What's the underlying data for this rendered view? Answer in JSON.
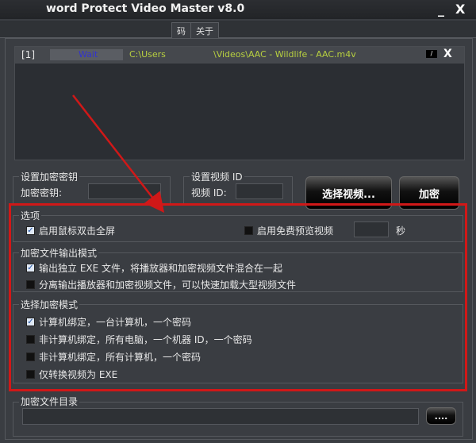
{
  "window": {
    "title": "word Protect Video Master v8.0",
    "minimize": "_",
    "close": "X"
  },
  "tabs": [
    {
      "label": "码"
    },
    {
      "label": "关于"
    }
  ],
  "file": {
    "index": "[1]",
    "status": "Wait",
    "path_start": "C:\\Users",
    "path_end": "\\Videos\\AAC - Wildlife - AAC.m4v",
    "remove": "X"
  },
  "key_group": {
    "title": "设置加密密钥",
    "label": "加密密钥:",
    "value": ""
  },
  "id_group": {
    "title": "设置视频 ID",
    "label": "视频 ID:",
    "value": ""
  },
  "buttons": {
    "select_video": "选择视频...",
    "encrypt": "加密",
    "browse": "...."
  },
  "options": {
    "title": "选项",
    "fullscreen": "启用鼠标双击全屏",
    "fullscreen_checked": true,
    "preview": "启用免费预览视频",
    "preview_checked": false,
    "preview_seconds": "",
    "seconds_unit": "秒"
  },
  "output_mode": {
    "title": "加密文件输出模式",
    "items": [
      {
        "label": "输出独立 EXE 文件，将播放器和加密视频文件混合在一起",
        "checked": true
      },
      {
        "label": "分离输出播放器和加密视频文件，可以快速加载大型视频文件",
        "checked": false
      }
    ]
  },
  "encrypt_mode": {
    "title": "选择加密模式",
    "items": [
      {
        "label": "计算机绑定，一台计算机，一个密码",
        "checked": true
      },
      {
        "label": "非计算机绑定，所有电脑，一个机器 ID，一个密码",
        "checked": false
      },
      {
        "label": "非计算机绑定，所有计算机，一个密码",
        "checked": false
      },
      {
        "label": "仅转换视频为 EXE",
        "checked": false
      }
    ]
  },
  "output_dir": {
    "title": "加密文件目录",
    "value": ""
  },
  "colors": {
    "annotation": "#d01818",
    "status": "#3333cc",
    "path": "#b8d040"
  }
}
